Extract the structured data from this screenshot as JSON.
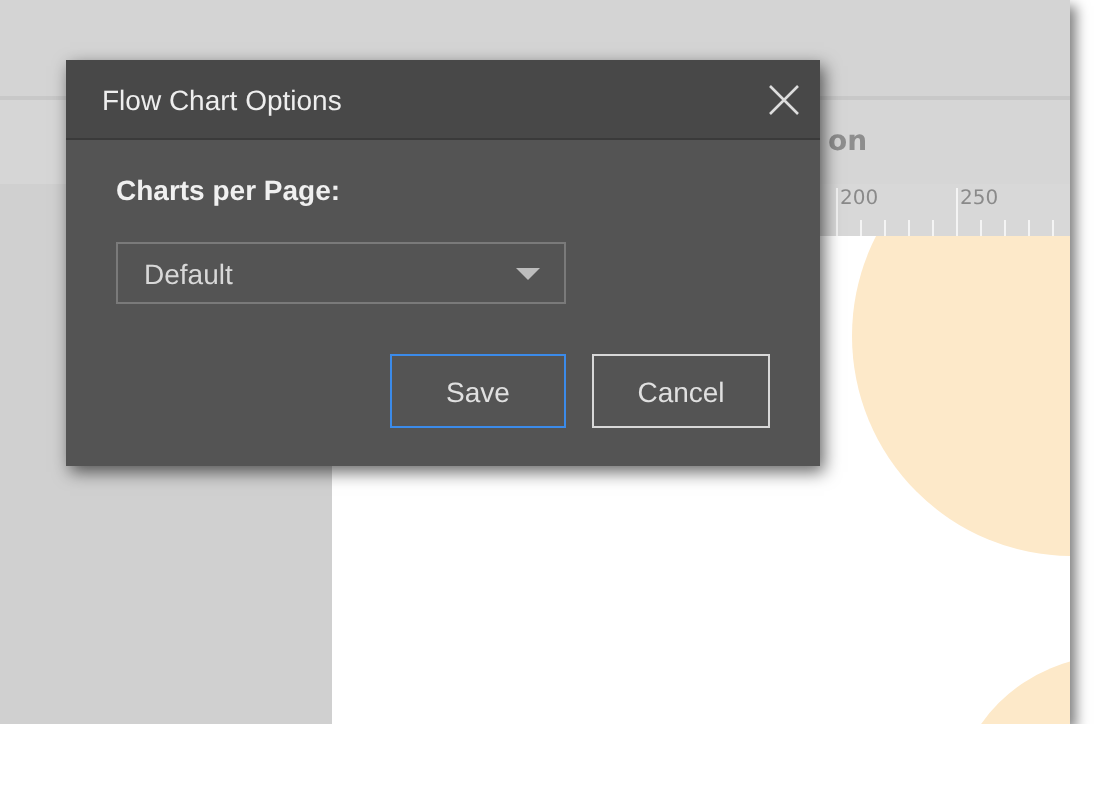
{
  "app": {
    "tab_label": "on",
    "ruler_labels": [
      "200",
      "250"
    ]
  },
  "dialog": {
    "title": "Flow Chart Options",
    "field_label": "Charts per Page:",
    "select": {
      "value": "Default"
    },
    "buttons": [
      {
        "label": "Save",
        "focused": true
      },
      {
        "label": "Cancel",
        "focused": false
      }
    ]
  }
}
